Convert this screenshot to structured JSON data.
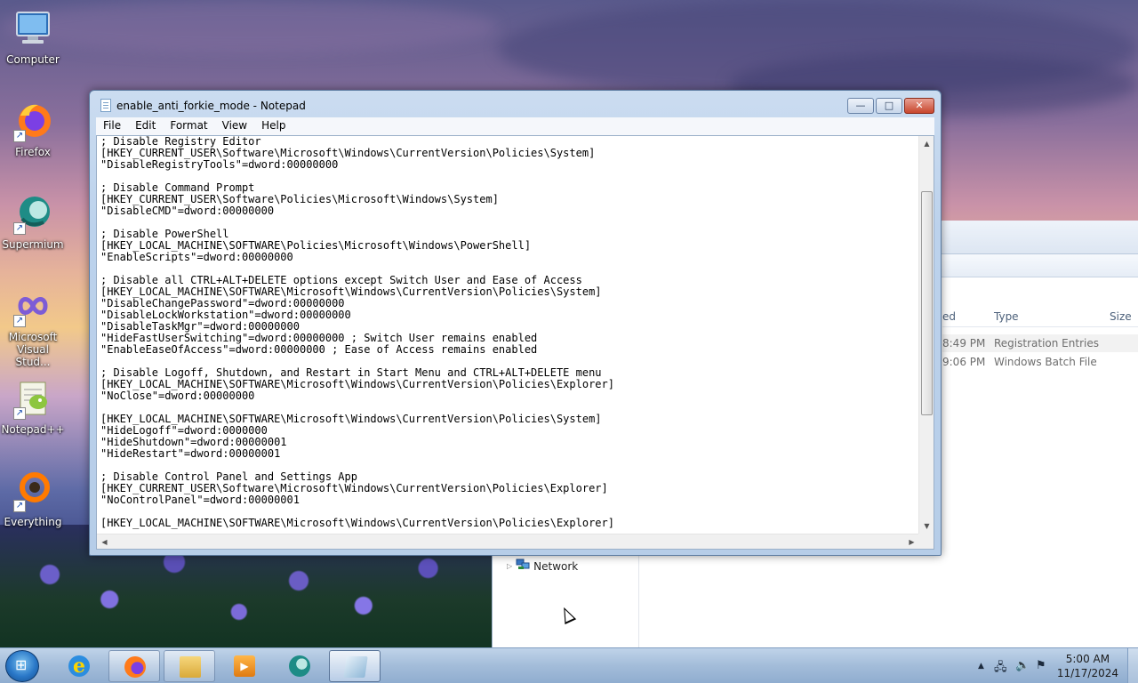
{
  "desktop": {
    "icons": [
      {
        "label": "Computer",
        "icon": "computer-icon"
      },
      {
        "label": "Firefox",
        "icon": "firefox-icon"
      },
      {
        "label": "Supermium",
        "icon": "supermium-icon"
      },
      {
        "label": "Microsoft Visual Stud...",
        "label_line1": "Microsoft",
        "label_line2": "Visual Stud...",
        "icon": "visual-studio-icon"
      },
      {
        "label": "Notepad++",
        "icon": "notepad-plus-plus-icon"
      },
      {
        "label": "Everything",
        "icon": "everything-icon"
      }
    ]
  },
  "explorer": {
    "columns": {
      "modified_partial": "ed",
      "type": "Type",
      "size": "Size"
    },
    "rows": [
      {
        "time_partial": "8:49 PM",
        "type": "Registration Entries"
      },
      {
        "time_partial": "9:06 PM",
        "type": "Windows Batch File"
      }
    ],
    "nav_network": "Network"
  },
  "notepad": {
    "title": "enable_anti_forkie_mode - Notepad",
    "menu": [
      "File",
      "Edit",
      "Format",
      "View",
      "Help"
    ],
    "controls": {
      "minimize": "—",
      "maximize": "□",
      "close": "✕"
    },
    "content_lines": [
      "; Disable Registry Editor",
      "[HKEY_CURRENT_USER\\Software\\Microsoft\\Windows\\CurrentVersion\\Policies\\System]",
      "\"DisableRegistryTools\"=dword:00000000",
      "",
      "; Disable Command Prompt",
      "[HKEY_CURRENT_USER\\Software\\Policies\\Microsoft\\Windows\\System]",
      "\"DisableCMD\"=dword:00000000",
      "",
      "; Disable PowerShell",
      "[HKEY_LOCAL_MACHINE\\SOFTWARE\\Policies\\Microsoft\\Windows\\PowerShell]",
      "\"EnableScripts\"=dword:00000000",
      "",
      "; Disable all CTRL+ALT+DELETE options except Switch User and Ease of Access",
      "[HKEY_LOCAL_MACHINE\\SOFTWARE\\Microsoft\\Windows\\CurrentVersion\\Policies\\System]",
      "\"DisableChangePassword\"=dword:00000000",
      "\"DisableLockWorkstation\"=dword:00000000",
      "\"DisableTaskMgr\"=dword:00000000",
      "\"HideFastUserSwitching\"=dword:00000000 ; Switch User remains enabled",
      "\"EnableEaseOfAccess\"=dword:00000000 ; Ease of Access remains enabled",
      "",
      "; Disable Logoff, Shutdown, and Restart in Start Menu and CTRL+ALT+DELETE menu",
      "[HKEY_LOCAL_MACHINE\\SOFTWARE\\Microsoft\\Windows\\CurrentVersion\\Policies\\Explorer]",
      "\"NoClose\"=dword:00000000",
      "",
      "[HKEY_LOCAL_MACHINE\\SOFTWARE\\Microsoft\\Windows\\CurrentVersion\\Policies\\System]",
      "\"HideLogoff\"=dword:0000000",
      "\"HideShutdown\"=dword:00000001",
      "\"HideRestart\"=dword:00000001",
      "",
      "; Disable Control Panel and Settings App",
      "[HKEY_CURRENT_USER\\Software\\Microsoft\\Windows\\CurrentVersion\\Policies\\Explorer]",
      "\"NoControlPanel\"=dword:00000001",
      "",
      "[HKEY_LOCAL_MACHINE\\SOFTWARE\\Microsoft\\Windows\\CurrentVersion\\Policies\\Explorer]"
    ]
  },
  "taskbar": {
    "items": [
      "start-orb",
      "internet-explorer-icon",
      "firefox-icon",
      "file-explorer-icon",
      "media-player-icon",
      "supermium-icon",
      "notepad-icon"
    ],
    "clock": {
      "time": "5:00 AM",
      "date": "11/17/2024"
    },
    "tray_icons": [
      "show-hidden-icons",
      "network-tray-icon",
      "volume-icon",
      "action-center-flag-icon"
    ]
  }
}
